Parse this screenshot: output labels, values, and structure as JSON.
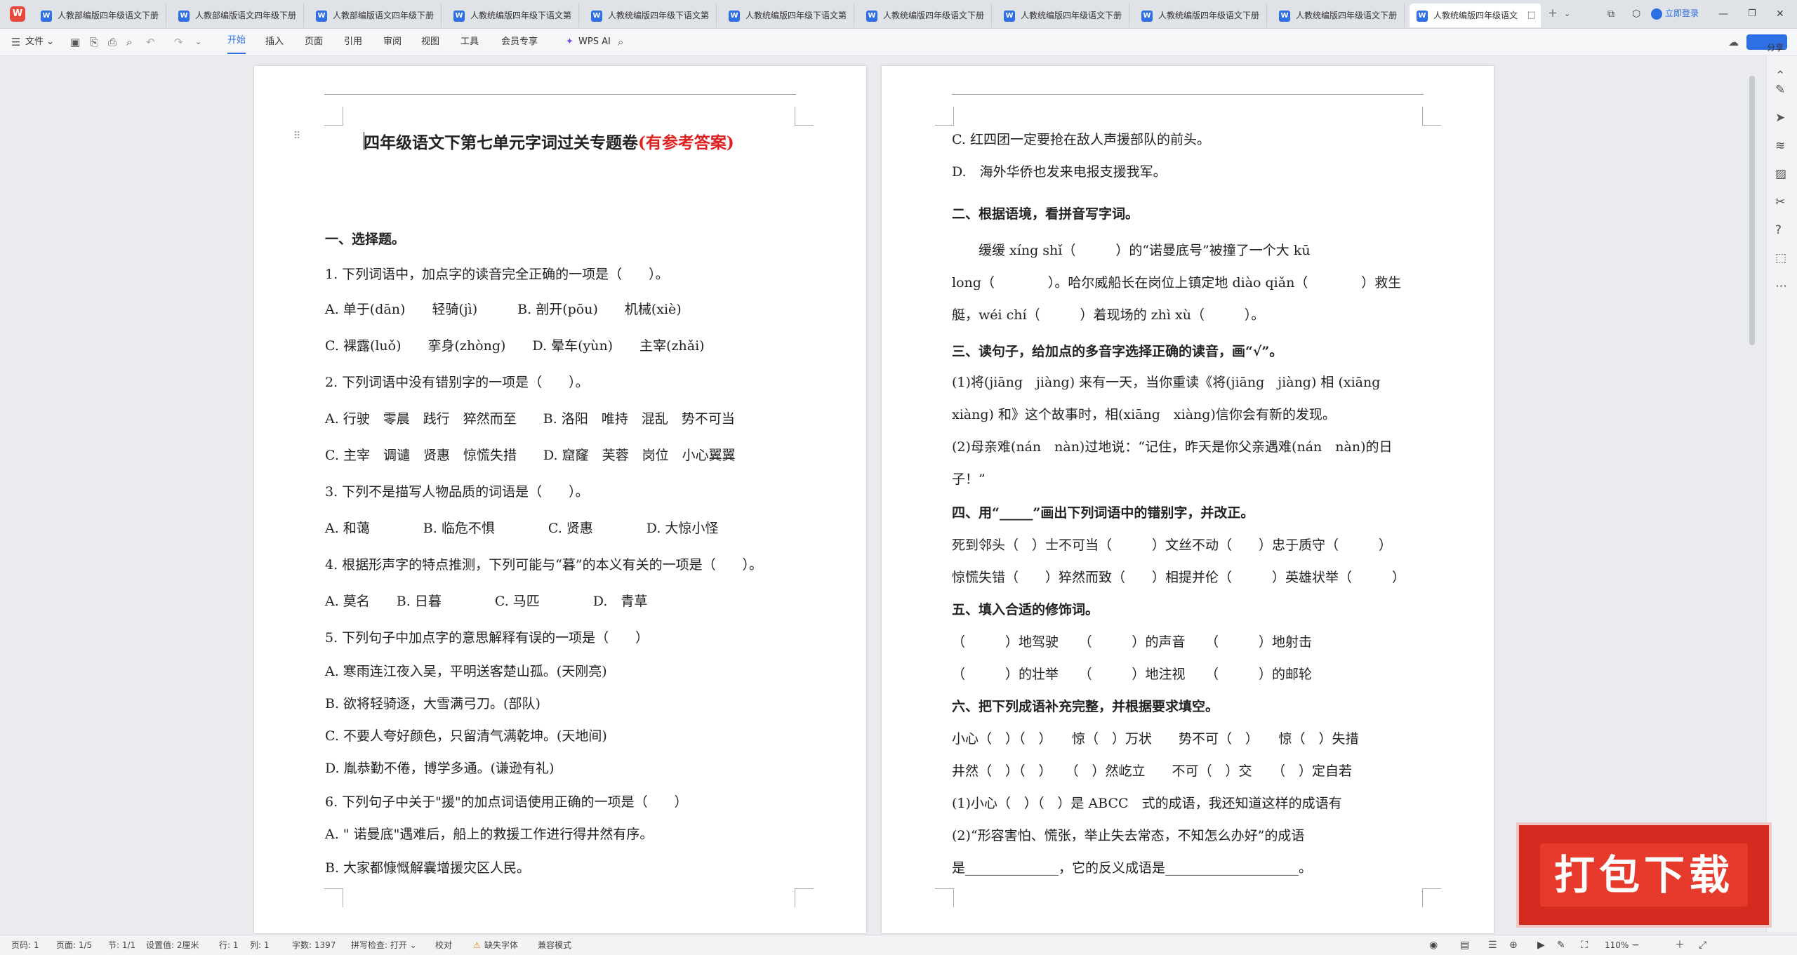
{
  "tabs": [
    "人教部编版四年级语文下册",
    "人教部编版语文四年级下册",
    "人教部编版语文四年级下册",
    "人教统编版四年级下语文第",
    "人教统编版四年级下语文第",
    "人教统编版四年级下语文第",
    "人教统编版四年级语文下册",
    "人教统编版四年级语文下册",
    "人教统编版四年级语文下册",
    "人教统编版四年级语文下册",
    "人教统编版四年级语文"
  ],
  "app_logo": "W",
  "login": "立即登录",
  "menu": {
    "file": "文件",
    "items": [
      "开始",
      "插入",
      "页面",
      "引用",
      "审阅",
      "视图",
      "工具",
      "会员专享"
    ],
    "active": "开始",
    "wps_ai": "WPS AI",
    "share": "分享"
  },
  "page1": {
    "title_black": "四年级语文下第七单元字词过关专题卷",
    "title_red": "(有参考答案)",
    "lines": [
      {
        "t": "一、选择题。",
        "b": true
      },
      {
        "t": "1. 下列词语中，加点字的读音完全正确的一项是（　　）。"
      },
      {
        "t": "A. 单于(dān)　　轻骑(jì)　　　B. 剖开(pōu)　　机械(xiè)"
      },
      {
        "t": "C. 裸露(luǒ)　　挛身(zhòng)　　D. 晕车(yùn)　　主宰(zhǎi)"
      },
      {
        "t": "2. 下列词语中没有错别字的一项是（　　）。"
      },
      {
        "t": "A. 行驶　零晨　践行　猝然而至　　B. 洛阳　唯持　混乱　势不可当"
      },
      {
        "t": "C. 主宰　调谴　贤惠　惊慌失措　　D. 窟窿　芙蓉　岗位　小心翼翼"
      },
      {
        "t": "3. 下列不是描写人物品质的词语是（　　）。"
      },
      {
        "t": "A. 和蔼　　　　B. 临危不惧　　　　C. 贤惠　　　　D. 大惊小怪"
      },
      {
        "t": "4. 根据形声字的特点推测，下列可能与“暮”的本义有关的一项是（　　）。"
      },
      {
        "t": "A. 莫名　　B. 日暮　　　　C. 马匹　　　　D.　青草"
      },
      {
        "t": "5. 下列句子中加点字的意思解释有误的一项是（　　）"
      },
      {
        "t": "A. 寒雨连江夜入吴，平明送客楚山孤。(天刚亮)"
      },
      {
        "t": "B. 欲将轻骑逐，大雪满弓刀。(部队)"
      },
      {
        "t": "C. 不要人夸好颜色，只留清气满乾坤。(天地间)"
      },
      {
        "t": "D. 胤恭勤不倦，博学多通。(谦逊有礼)"
      },
      {
        "t": "6. 下列句子中关于\"援\"的加点词语使用正确的一项是（　　）"
      },
      {
        "t": "A. \" 诺曼底\"遇难后，船上的救援工作进行得井然有序。"
      },
      {
        "t": "B. 大家都慷慨解囊增援灾区人民。"
      }
    ]
  },
  "page2": {
    "lines": [
      {
        "t": "C. 红四团一定要抢在敌人声援部队的前头。"
      },
      {
        "t": "D.　海外华侨也发来电报支援我军。"
      },
      {
        "t": "二、根据语境，看拼音写字词。",
        "b": true
      },
      {
        "t": "　　缓缓 xíng shǐ（　　　）的“诺曼底号”被撞了一个大 kū"
      },
      {
        "t": "long（　　　　）。哈尔威船长在岗位上镇定地 diào qiǎn（　　　　）救生"
      },
      {
        "t": "艇，wéi chí（　　　）着现场的 zhì xù（　　　）。"
      },
      {
        "t": "三、读句子，给加点的多音字选择正确的读音，画“√”。",
        "b": true
      },
      {
        "t": "(1)将(jiāng　jiàng) 来有一天，当你重读《将(jiāng　jiàng) 相 (xiāng"
      },
      {
        "t": "xiàng) 和》这个故事时，相(xiāng　xiàng)信你会有新的发现。"
      },
      {
        "t": "(2)母亲难(nán　nàn)过地说：“记住，昨天是你父亲遇难(nán　nàn)的日"
      },
      {
        "t": "子！”"
      },
      {
        "t": "四、用“_____”画出下列词语中的错别字，并改正。",
        "b": true
      },
      {
        "t": "死到邻头（　）士不可当（　　　）文丝不动（　　）忠于质守（　　　）"
      },
      {
        "t": "惊慌失错（　　）猝然而致（　　）相提并伦（　　　）英雄状举（　　　）"
      },
      {
        "t": "五、填入合适的修饰词。",
        "b": true
      },
      {
        "t": "（　　　）地驾驶　　（　　　）的声音　　（　　　）地射击"
      },
      {
        "t": "（　　　）的壮举　　（　　　）地注视　　（　　　）的邮轮"
      },
      {
        "t": "六、把下列成语补充完整，并根据要求填空。",
        "b": true
      },
      {
        "t": "小心（　）（　）　　惊（　）万状　　势不可（　）　　惊（　）失措"
      },
      {
        "t": "井然（　）（　）　　（　）然屹立　　不可（　）交　　（　）定自若"
      },
      {
        "t": "(1)小心（　）（　）是 ABCC　式的成语，我还知道这样的成语有"
      },
      {
        "t": "(2)“形容害怕、慌张，举止失去常态，不知怎么办好”的成语"
      },
      {
        "t": "是______________，它的反义成语是____________________。"
      }
    ]
  },
  "status": {
    "page_no": "页码: 1",
    "pages": "页面: 1/5",
    "section": "节: 1/1",
    "setting": "设置值: 2厘米",
    "row": "行: 1",
    "col": "列: 1",
    "words": "字数: 1397",
    "spell": "拼写检查: 打开",
    "proof": "校对",
    "missing_font": "缺失字体",
    "compat": "兼容模式",
    "zoom": "110%"
  },
  "promo_text": "打包下载"
}
